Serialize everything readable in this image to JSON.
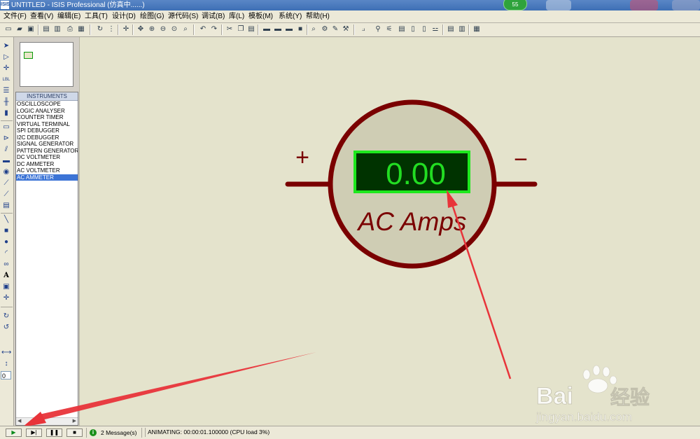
{
  "window": {
    "title": "UNTITLED - ISIS Professional (仿真中......)",
    "app_icon_text": "ISIS",
    "badge_count": "55"
  },
  "menu": [
    "文件(F)",
    "查看(V)",
    "编辑(E)",
    "工具(T)",
    "设计(D)",
    "绘图(G)",
    "源代码(S)",
    "调试(B)",
    "库(L)",
    "模板(M)",
    "系统(Y)",
    "帮助(H)"
  ],
  "left_strip": {
    "label_tool": "LBL",
    "angle_value": "0"
  },
  "instruments": {
    "header": "INSTRUMENTS",
    "items": [
      "OSCILLOSCOPE",
      "LOGIC ANALYSER",
      "COUNTER TIMER",
      "VIRTUAL TERMINAL",
      "SPI DEBUGGER",
      "I2C DEBUGGER",
      "SIGNAL GENERATOR",
      "PATTERN GENERATOR",
      "DC VOLTMETER",
      "DC AMMETER",
      "AC VOLTMETER",
      "AC AMMETER"
    ],
    "selected": "AC AMMETER"
  },
  "meter": {
    "reading": "0.00",
    "label": "AC Amps",
    "plus": "+",
    "minus": "−",
    "body_color": "#7a0000",
    "face_color": "#cfcdb4",
    "display_bg": "#003300",
    "display_border": "#1ee81e",
    "digit_color": "#22dd22"
  },
  "status": {
    "messages": "2 Message(s)",
    "text": "ANIMATING: 00:00:01.100000 (CPU load 3%)"
  },
  "sim_controls": {
    "play": "▶",
    "step": "▶|",
    "pause": "❚❚",
    "stop": "■"
  },
  "watermark": {
    "brand": "Bai",
    "brand_suffix": "经验",
    "url": "jingyan.baidu.com"
  },
  "colors": {
    "canvas": "#e4e3cc",
    "annotation_arrow": "#e8343a",
    "selection": "#3c74d6"
  }
}
